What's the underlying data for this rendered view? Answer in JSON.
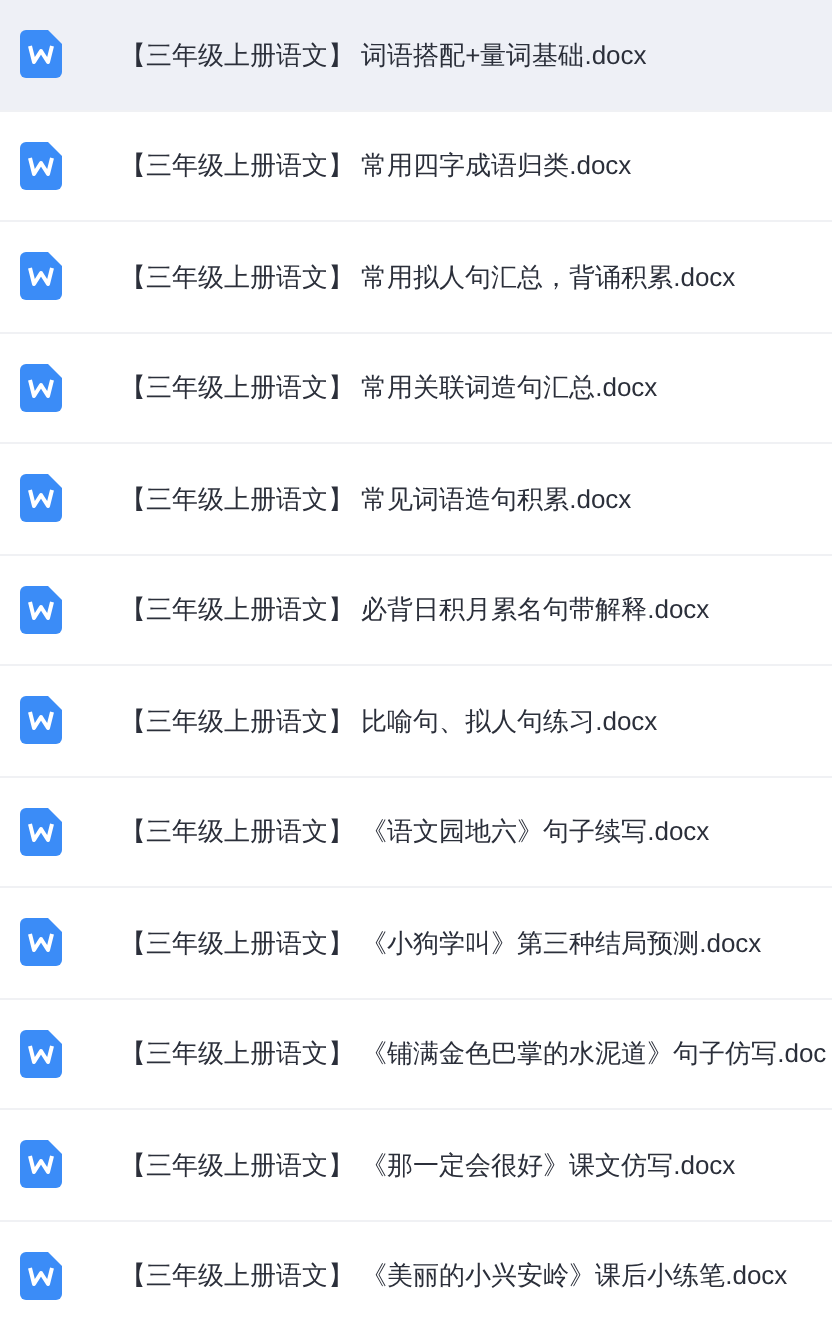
{
  "files": [
    {
      "name": "【三年级上册语文】 词语搭配+量词基础.docx",
      "selected": true
    },
    {
      "name": "【三年级上册语文】 常用四字成语归类.docx",
      "selected": false
    },
    {
      "name": "【三年级上册语文】 常用拟人句汇总，背诵积累.docx",
      "selected": false
    },
    {
      "name": "【三年级上册语文】 常用关联词造句汇总.docx",
      "selected": false
    },
    {
      "name": "【三年级上册语文】 常见词语造句积累.docx",
      "selected": false
    },
    {
      "name": "【三年级上册语文】 必背日积月累名句带解释.docx",
      "selected": false
    },
    {
      "name": "【三年级上册语文】 比喻句、拟人句练习.docx",
      "selected": false
    },
    {
      "name": "【三年级上册语文】 《语文园地六》句子续写.docx",
      "selected": false
    },
    {
      "name": "【三年级上册语文】 《小狗学叫》第三种结局预测.docx",
      "selected": false
    },
    {
      "name": "【三年级上册语文】 《铺满金色巴掌的水泥道》句子仿写.doc",
      "selected": false
    },
    {
      "name": "【三年级上册语文】 《那一定会很好》课文仿写.docx",
      "selected": false
    },
    {
      "name": "【三年级上册语文】 《美丽的小兴安岭》课后小练笔.docx",
      "selected": false
    }
  ]
}
